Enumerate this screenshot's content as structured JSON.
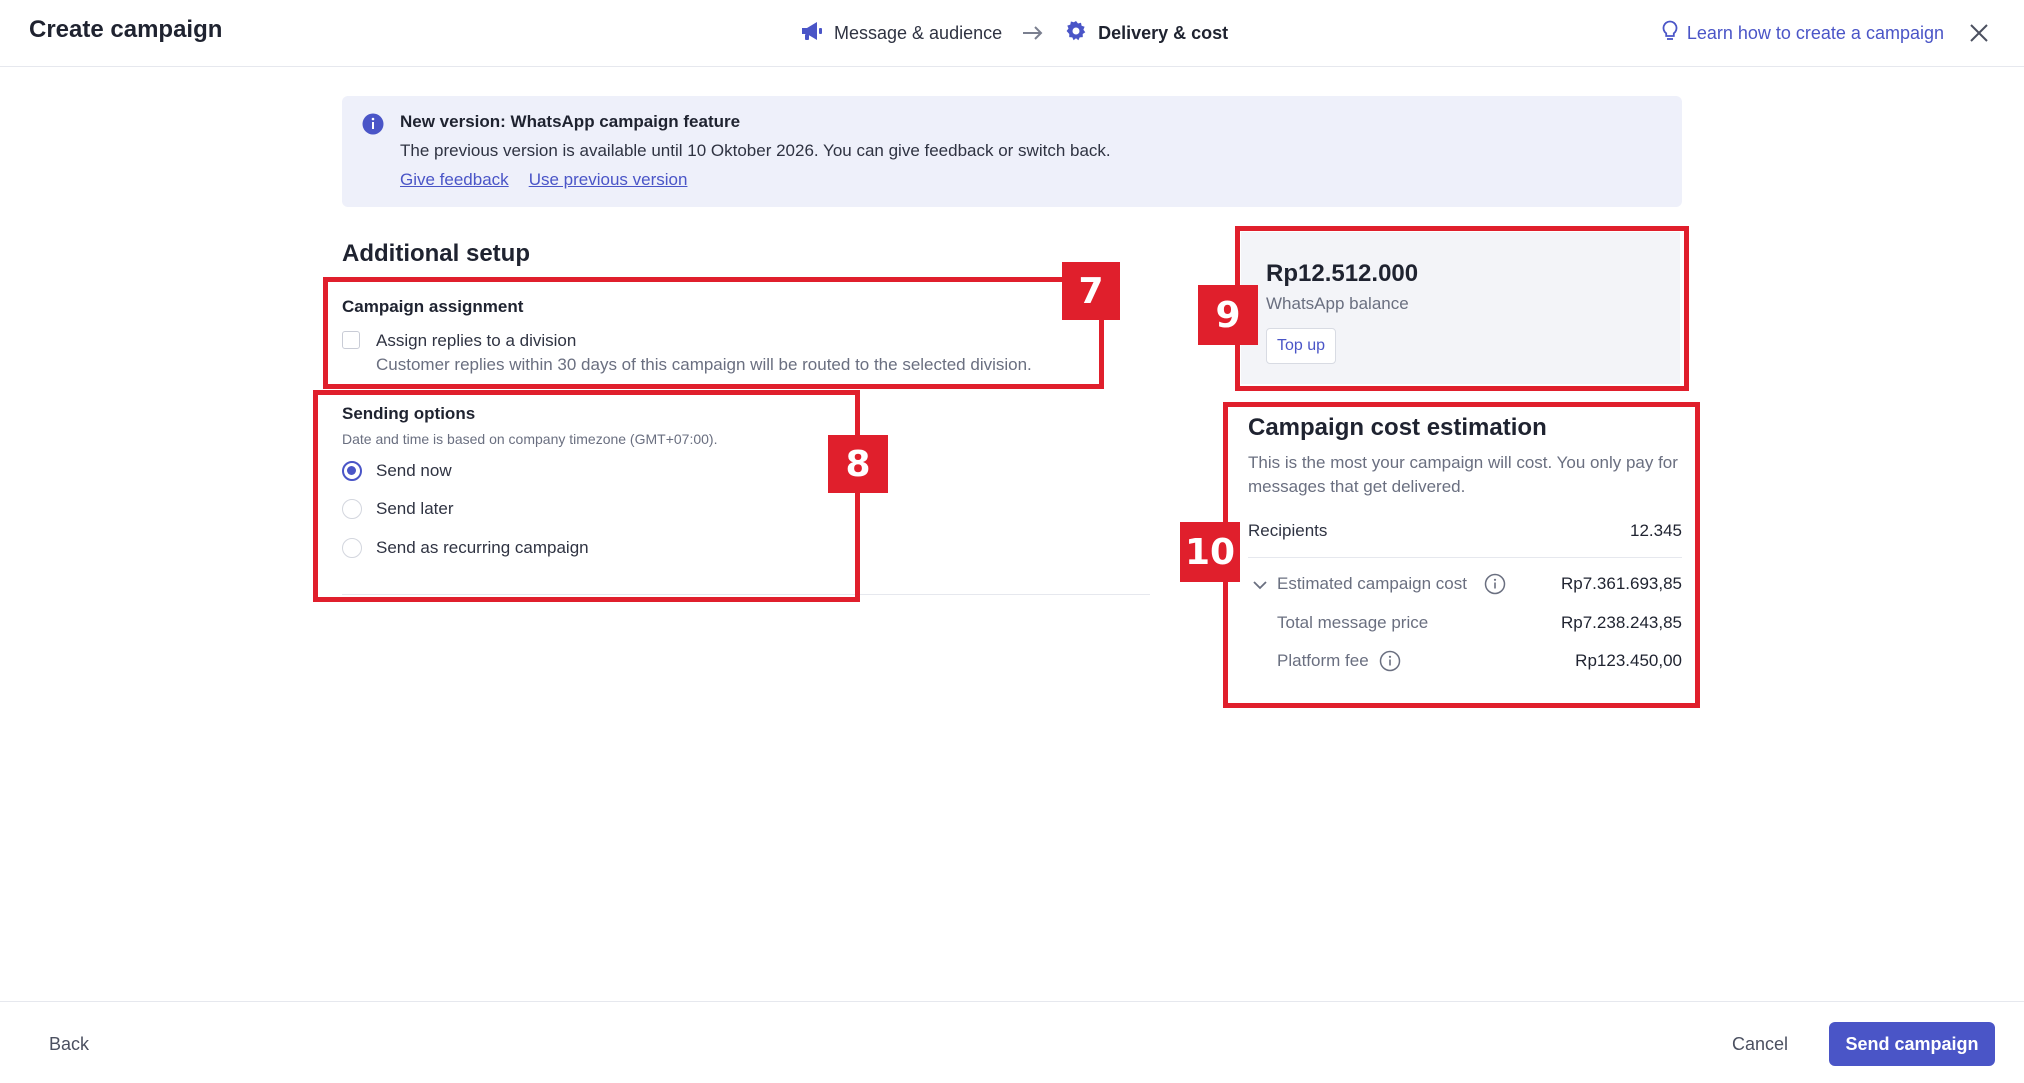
{
  "header": {
    "title": "Create campaign",
    "steps": [
      {
        "label": "Message & audience",
        "icon": "megaphone-icon"
      },
      {
        "label": "Delivery & cost",
        "icon": "gear-icon"
      }
    ],
    "learn_link": "Learn how to create a campaign"
  },
  "banner": {
    "title": "New version: WhatsApp campaign feature",
    "text": "The previous version is available until 10 Oktober 2026. You can give feedback or switch back.",
    "links": [
      "Give feedback",
      "Use previous version"
    ]
  },
  "setup": {
    "heading": "Additional setup",
    "assignment": {
      "title": "Campaign assignment",
      "checkbox_label": "Assign replies to a division",
      "checkbox_desc": "Customer replies within 30 days of this campaign will be routed to the selected division.",
      "checked": false
    },
    "sending": {
      "title": "Sending options",
      "note": "Date and time is based on company timezone (GMT+07:00).",
      "options": [
        "Send now",
        "Send later",
        "Send as recurring campaign"
      ],
      "selected": "Send now"
    }
  },
  "balance": {
    "amount": "Rp12.512.000",
    "label": "WhatsApp balance",
    "topup": "Top up"
  },
  "cost": {
    "title": "Campaign cost estimation",
    "desc": "This is the most your campaign will cost. You only pay for messages that get delivered.",
    "recipients_label": "Recipients",
    "recipients_value": "12.345",
    "estimated_label": "Estimated campaign cost",
    "estimated_value": "Rp7.361.693,85",
    "total_label": "Total message price",
    "total_value": "Rp7.238.243,85",
    "platform_label": "Platform fee",
    "platform_value": "Rp123.450,00"
  },
  "annotations": [
    "7",
    "8",
    "9",
    "10"
  ],
  "footer": {
    "back": "Back",
    "cancel": "Cancel",
    "send": "Send campaign"
  },
  "colors": {
    "accent": "#4a55c7",
    "annotation_red": "#e01f2c",
    "banner_bg": "#eef0fa"
  }
}
